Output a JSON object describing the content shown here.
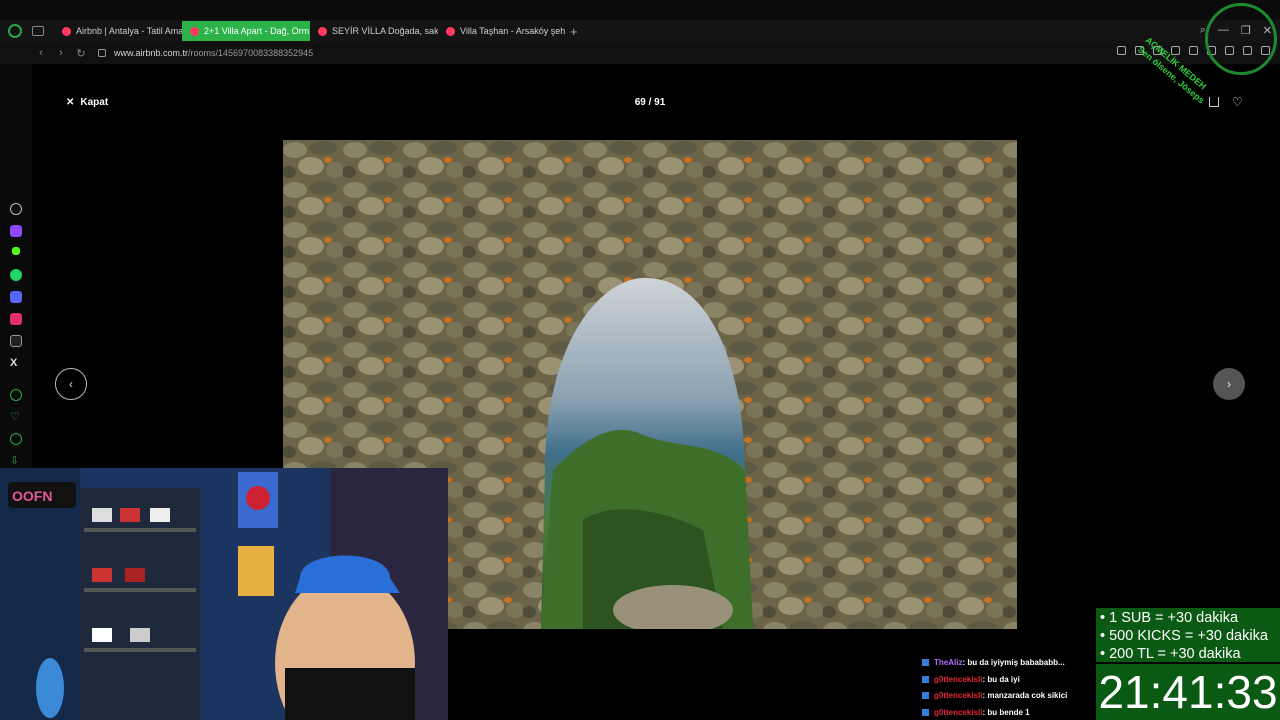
{
  "browser": {
    "tabs": [
      {
        "label": "Airbnb | Antalya - Tatil Ama",
        "active": false
      },
      {
        "label": "2+1 Villa Apart - Dağ, Orm",
        "active": true
      },
      {
        "label": "SEYİR VİLLA Doğada, saki",
        "active": false
      },
      {
        "label": "Villa Taşhan - Arsaköy şeh",
        "active": false
      }
    ],
    "new_tab": "+",
    "url_domain": "www.airbnb.com.tr",
    "url_path": "/rooms/1456970083388352945"
  },
  "viewer": {
    "close_label": "Kapat",
    "counter": "69 / 91",
    "prev_glyph": "‹",
    "next_glyph": "›"
  },
  "overlay": {
    "watermark_line1": "AÇMELİK MEDEH",
    "watermark_line2": "Sen ölsene, Jöseps",
    "chat": [
      {
        "user": "TheAliz",
        "user_color": "#b46cff",
        "message": ": bu da iyiymiş babababb..."
      },
      {
        "user": "g0ttencekisli",
        "user_color": "#e0263c",
        "message": ": bu da iyi"
      },
      {
        "user": "g0ttencekisli",
        "user_color": "#e0263c",
        "message": ": manzarada cok sikici"
      },
      {
        "user": "g0ttencekisli",
        "user_color": "#e0263c",
        "message": ": bu bende 1"
      }
    ],
    "subs": [
      "• 1 SUB = +30 dakika",
      "• 500 KICKS = +30 dakika",
      "• 200 TL = +30 dakika"
    ],
    "timer": "21:41:33"
  },
  "colors": {
    "active_tab": "#2bb34a",
    "airbnb": "#ff385c",
    "overlay_green": "#0a5a14"
  }
}
